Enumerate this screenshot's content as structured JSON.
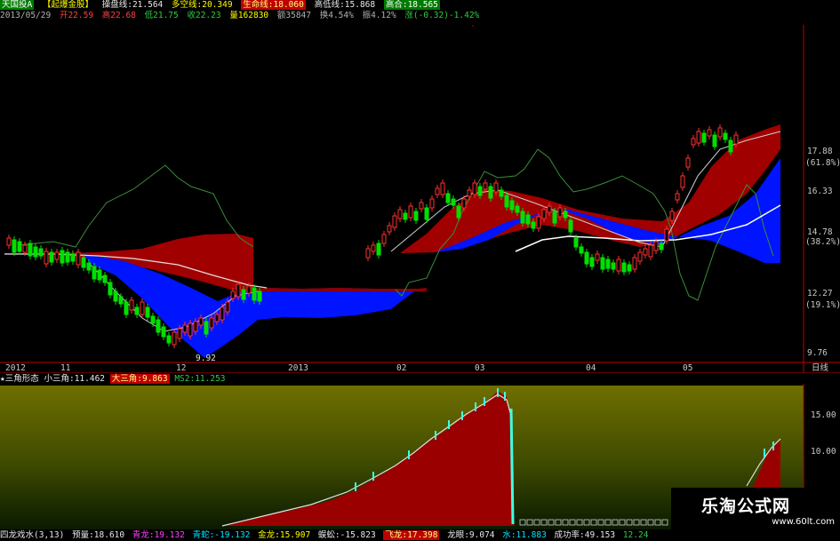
{
  "header": {
    "stock_name": "天国投A",
    "formula_tag": "【起爆金股】",
    "ma1": "操盘线:21.564",
    "ma2": "多空线:20.349",
    "lifeline": "生命线:18.060",
    "hi_line": "高低线:15.868",
    "agree": "高合:18.565",
    "date": "2013/05/29",
    "open": "开22.59",
    "high": "高22.68",
    "low": "低21.75",
    "close": "收22.23",
    "vol": "量162830",
    "amount": "额35847",
    "turnover": "换4.54%",
    "amplitude": "振4.12%",
    "change": "涨(-0.32)-1.42%"
  },
  "price_axis": [
    "17.88",
    "(61.8%)",
    "16.33",
    "14.78",
    "(38.2%)",
    "12.27",
    "(19.1%)",
    "9.76"
  ],
  "low_label": "9.92",
  "date_axis": [
    "2012",
    "11",
    "12",
    "2013",
    "02",
    "03",
    "04",
    "05"
  ],
  "period_label": "日线",
  "indicator": {
    "title": "★三角形态",
    "small": "小三角:11.462",
    "big": "大三角:9.863",
    "ms2": "MS2:11.253",
    "axis": [
      "15.00",
      "10.00"
    ]
  },
  "bottom_bar": {
    "title": "四龙戏水(3,13)",
    "items": [
      "预量:18.610",
      "青龙:19.132",
      "青蛇:-19.132",
      "金龙:15.907",
      "蜈蚣:-15.823",
      "飞龙:17.398",
      "龙眼:9.074",
      "水:11.883",
      "成功率:49.153",
      "12.24"
    ]
  },
  "watermark": {
    "title": "乐淘公式网",
    "url": "www.60lt.com"
  },
  "colors": {
    "up": "#ff3030",
    "down": "#00e000",
    "bg": "#000000",
    "red_band": "#b00000",
    "blue_band": "#0020ff",
    "olive": "#6b6b00"
  }
}
